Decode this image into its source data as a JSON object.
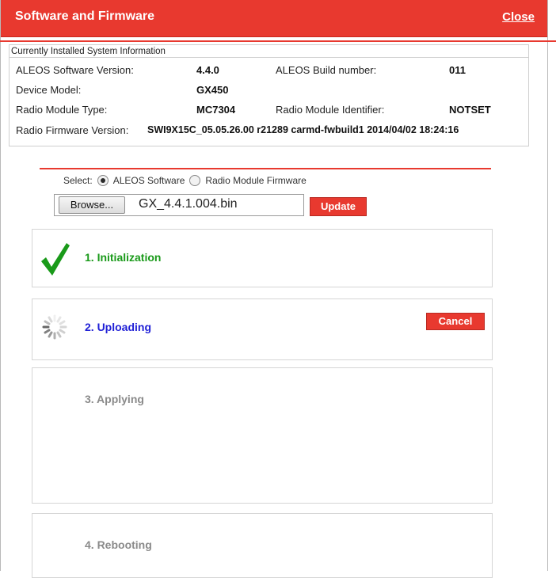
{
  "dialog": {
    "title": "Software and Firmware",
    "close_label": "Close"
  },
  "system_info": {
    "header": "Currently Installed System Information",
    "software_version_label": "ALEOS Software Version:",
    "software_version": "4.4.0",
    "build_number_label": "ALEOS Build number:",
    "build_number": "011",
    "device_model_label": "Device Model:",
    "device_model": "GX450",
    "radio_module_type_label": "Radio Module Type:",
    "radio_module_type": "MC7304",
    "radio_module_identifier_label": "Radio Module Identifier:",
    "radio_module_identifier": "NOTSET",
    "radio_firmware_label": "Radio Firmware Version:",
    "radio_firmware": "SWI9X15C_05.05.26.00 r21289 carmd-fwbuild1 2014/04/02 18:24:16"
  },
  "update_form": {
    "select_label": "Select:",
    "option_software": "ALEOS Software",
    "option_radio": "Radio Module Firmware",
    "selected": "ALEOS Software",
    "browse_label": "Browse...",
    "file_name": "GX_4.4.1.004.bin",
    "update_label": "Update"
  },
  "steps": [
    {
      "label": "1. Initialization",
      "status": "complete",
      "color": "#1a9a1a",
      "icon": "checkmark-icon"
    },
    {
      "label": "2. Uploading",
      "status": "in-progress",
      "color": "#1f1fd6",
      "icon": "spinner-icon",
      "cancel_label": "Cancel"
    },
    {
      "label": "3. Applying",
      "status": "pending",
      "color": "#8a8a8a"
    },
    {
      "label": "4. Rebooting",
      "status": "pending",
      "color": "#8a8a8a"
    }
  ],
  "colors": {
    "accent": "#e8392f",
    "complete": "#1a9a1a",
    "active": "#1f1fd6",
    "pending": "#8a8a8a"
  }
}
